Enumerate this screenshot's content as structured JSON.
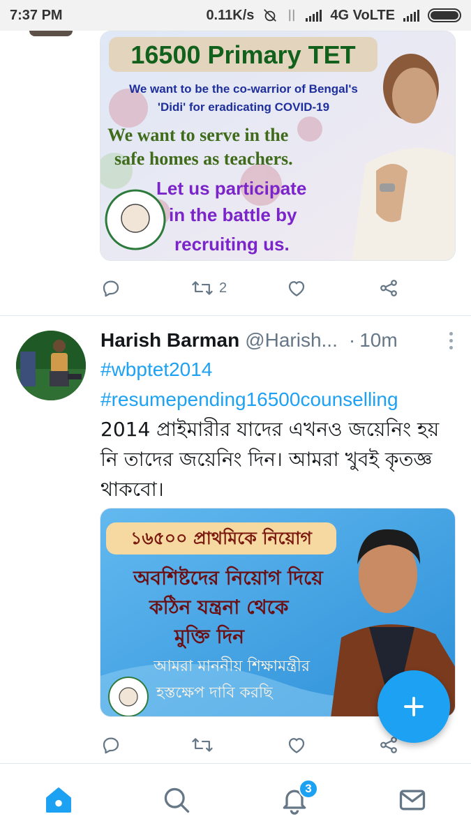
{
  "status_bar": {
    "time": "7:37 PM",
    "speed": "0.11K/s",
    "network": "4G VoLTE"
  },
  "tweet1": {
    "image": {
      "headline": "16500 Primary TET",
      "line1": "We want to be the co-warrior of Bengal's",
      "line2": "'Didi' for eradicating COVID-19",
      "line3": "We want to serve in the",
      "line4": "safe homes as teachers.",
      "line5": "Let us participate",
      "line6": "in the battle by",
      "line7": "recruiting us."
    },
    "retweet_count": "2"
  },
  "tweet2": {
    "name": "Harish Barman",
    "handle": "@Harish...",
    "dot": "·",
    "time": "10m",
    "hashtag1": "#wbptet2014",
    "hashtag2": "#resumepending16500counselling",
    "text": "2014 প্রাইমারীর যাদের এখনও জয়েনিং হয় নি তাদের জয়েনিং দিন। আমরা খুবই কৃতজ্ঞ থাকবো।",
    "image": {
      "headline": "১৬৫০০ প্রাথমিকে নিয়োগ",
      "line1": "অবশিষ্টদের নিয়োগ দিয়ে",
      "line2": "কঠিন যন্ত্রনা থেকে",
      "line3": "মুক্তি দিন",
      "line4": "আমরা মাননীয় শিক্ষামন্ত্রীর",
      "line5": "হস্তক্ষেপ দাবি করছি"
    }
  },
  "bottom_nav": {
    "notifications_badge": "3",
    "active": "home"
  },
  "colors": {
    "accent": "#1da1f2",
    "icon_gray": "#657786",
    "divider": "#e1e8ed"
  },
  "icons": [
    "reply-icon",
    "retweet-icon",
    "like-icon",
    "share-icon",
    "home-icon",
    "search-icon",
    "notifications-icon",
    "messages-icon",
    "compose-icon"
  ]
}
